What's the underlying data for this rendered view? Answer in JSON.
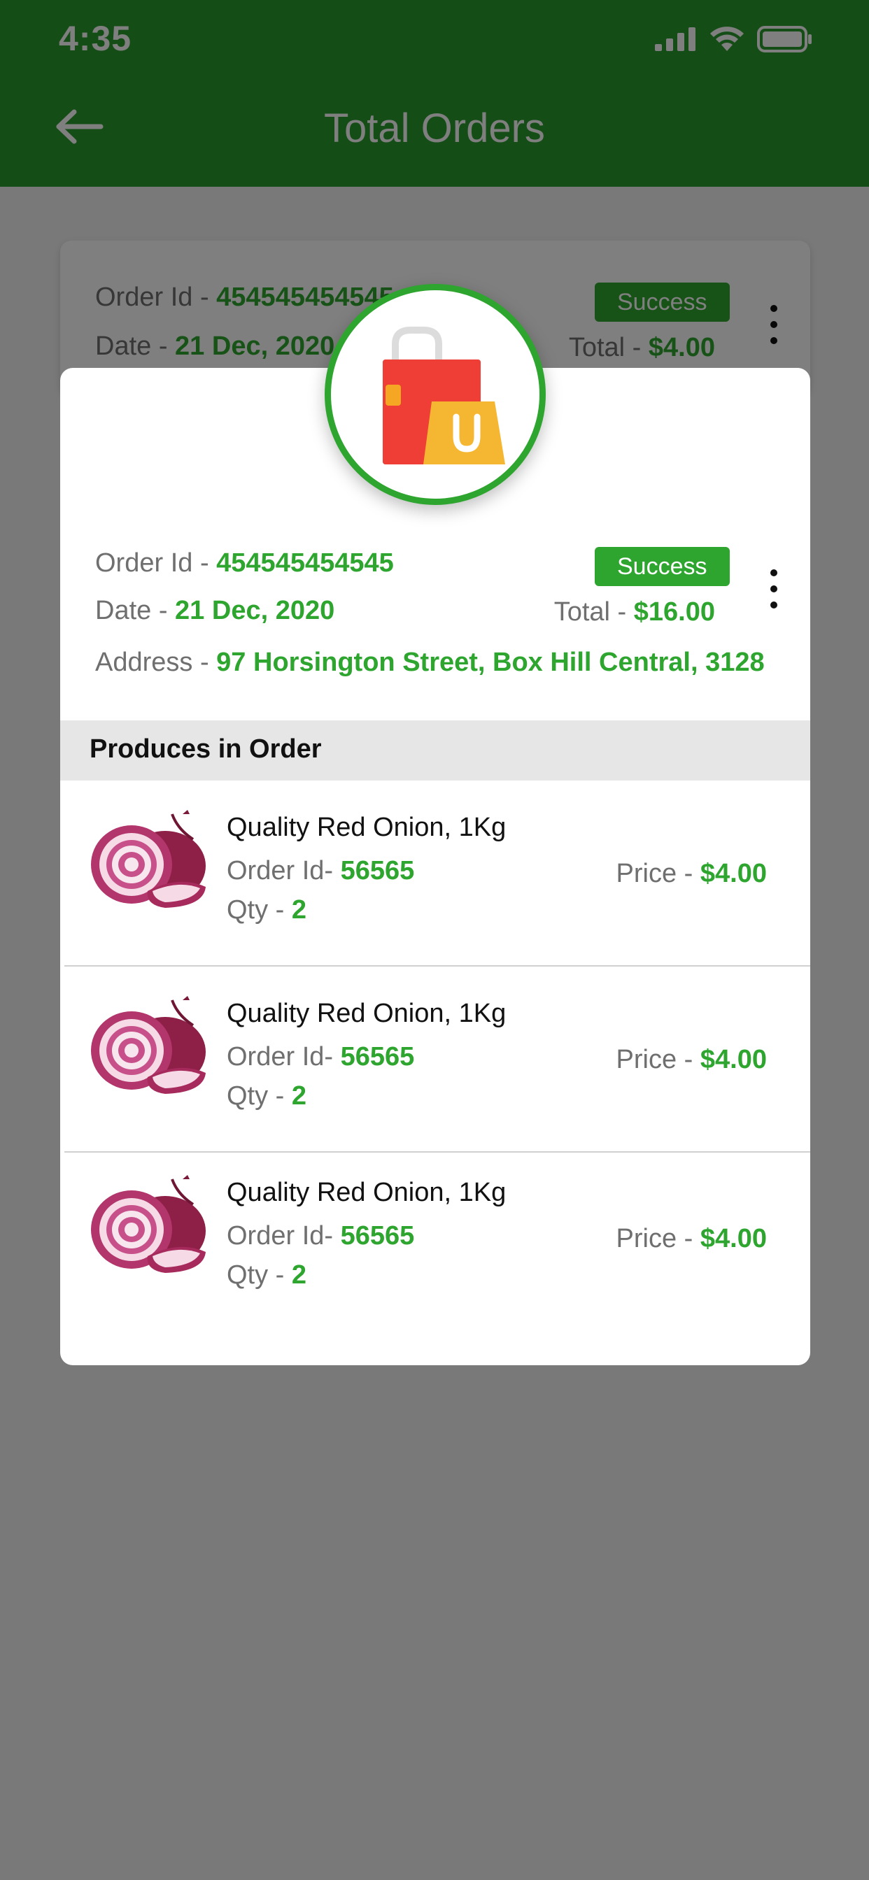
{
  "status": {
    "time": "4:35"
  },
  "header": {
    "title": "Total Orders"
  },
  "background_order": {
    "order_id_label": "Order Id - ",
    "order_id": "454545454545",
    "date_label": "Date - ",
    "date": "21 Dec, 2020",
    "status": "Success",
    "total_label": "Total - ",
    "total": "$4.00"
  },
  "modal": {
    "icon": "shopping-bags-icon",
    "order_id_label": "Order Id - ",
    "order_id": "454545454545",
    "date_label": "Date - ",
    "date": "21 Dec, 2020",
    "status": "Success",
    "total_label": "Total - ",
    "total": "$16.00",
    "address_label": "Address - ",
    "address": "97 Horsington Street, Box Hill Central, 3128",
    "section_title": "Produces in Order",
    "items": [
      {
        "name": "Quality Red Onion, 1Kg",
        "order_id_label": "Order Id- ",
        "order_id": "56565",
        "qty_label": "Qty - ",
        "qty": "2",
        "price_label": "Price - ",
        "price": "$4.00"
      },
      {
        "name": "Quality Red Onion, 1Kg",
        "order_id_label": "Order Id- ",
        "order_id": "56565",
        "qty_label": "Qty - ",
        "qty": "2",
        "price_label": "Price - ",
        "price": "$4.00"
      },
      {
        "name": "Quality Red Onion, 1Kg",
        "order_id_label": "Order Id- ",
        "order_id": "56565",
        "qty_label": "Qty - ",
        "qty": "2",
        "price_label": "Price - ",
        "price": "$4.00"
      }
    ]
  },
  "colors": {
    "brand_green": "#2b9a2f",
    "value_green": "#2ea52f",
    "overlay": "rgba(0,0,0,0.5)"
  }
}
